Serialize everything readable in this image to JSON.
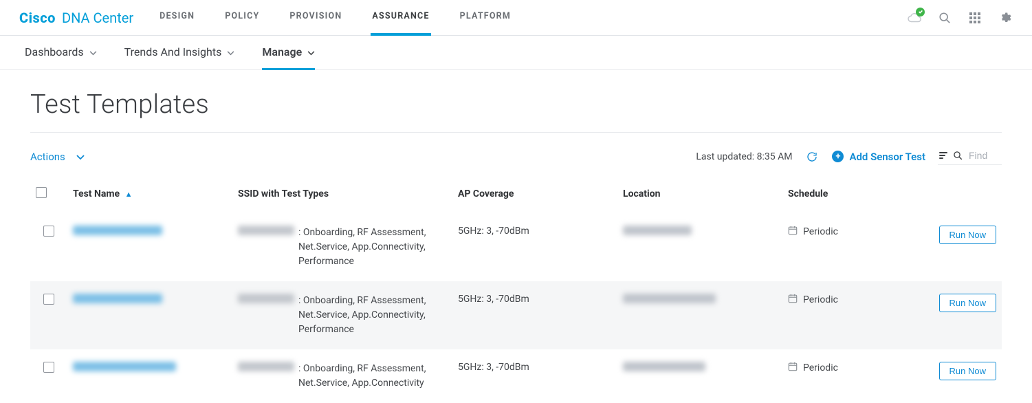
{
  "brand": {
    "cisco": "Cisco",
    "product": "DNA Center"
  },
  "mainnav": {
    "items": [
      {
        "label": "DESIGN"
      },
      {
        "label": "POLICY"
      },
      {
        "label": "PROVISION"
      },
      {
        "label": "ASSURANCE",
        "active": true
      },
      {
        "label": "PLATFORM"
      }
    ]
  },
  "subnav": {
    "items": [
      {
        "label": "Dashboards"
      },
      {
        "label": "Trends And Insights"
      },
      {
        "label": "Manage",
        "active": true
      }
    ]
  },
  "page": {
    "title": "Test Templates"
  },
  "toolbar": {
    "actions_label": "Actions",
    "last_updated": "Last updated: 8:35 AM",
    "add_label": "Add Sensor Test",
    "find_placeholder": "Find"
  },
  "table": {
    "headers": {
      "test_name": "Test Name",
      "ssid": "SSID with Test Types",
      "ap": "AP Coverage",
      "location": "Location",
      "schedule": "Schedule"
    },
    "run_label": "Run Now",
    "rows": [
      {
        "ssid_tests": "Onboarding, RF Assessment, Net.Service, App.Connectivity, Performance",
        "ap": "5GHz: 3, -70dBm",
        "schedule": "Periodic"
      },
      {
        "ssid_tests": "Onboarding, RF Assessment, Net.Service, App.Connectivity, Performance",
        "ap": "5GHz: 3, -70dBm",
        "schedule": "Periodic"
      },
      {
        "ssid_tests": "Onboarding, RF Assessment, Net.Service, App.Connectivity",
        "ap": "5GHz: 3, -70dBm",
        "schedule": "Periodic"
      }
    ]
  }
}
